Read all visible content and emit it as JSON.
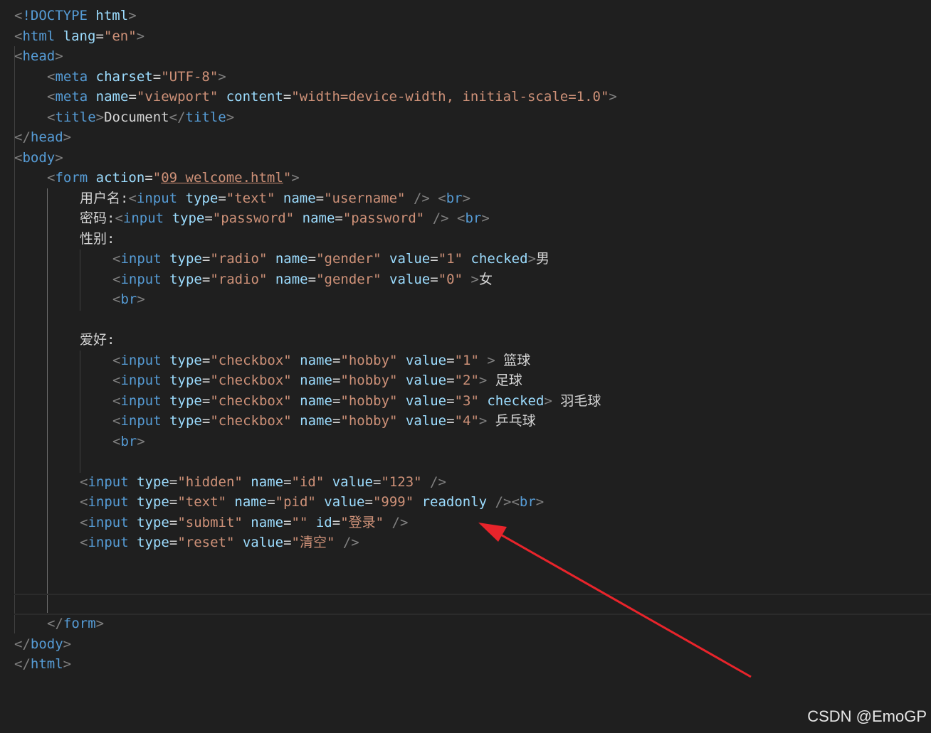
{
  "editor": {
    "theme": {
      "background": "#1f1f1f",
      "tag": "#569cd6",
      "attribute": "#9cdcfe",
      "string": "#ce9178",
      "text": "#d4d4d4",
      "punctuation": "#808080"
    },
    "lines": [
      {
        "t": [
          [
            "p",
            "<"
          ],
          [
            "tag",
            "!DOCTYPE"
          ],
          [
            "txt",
            " "
          ],
          [
            "attr",
            "html"
          ],
          [
            "p",
            ">"
          ]
        ]
      },
      {
        "t": [
          [
            "p",
            "<"
          ],
          [
            "tag",
            "html"
          ],
          [
            "txt",
            " "
          ],
          [
            "attr",
            "lang"
          ],
          [
            "txt",
            "="
          ],
          [
            "str",
            "\"en\""
          ],
          [
            "p",
            ">"
          ]
        ]
      },
      {
        "t": [
          [
            "p",
            "<"
          ],
          [
            "tag",
            "head"
          ],
          [
            "p",
            ">"
          ]
        ]
      },
      {
        "indent": 1,
        "t": [
          [
            "p",
            "<"
          ],
          [
            "tag",
            "meta"
          ],
          [
            "txt",
            " "
          ],
          [
            "attr",
            "charset"
          ],
          [
            "txt",
            "="
          ],
          [
            "str",
            "\"UTF-8\""
          ],
          [
            "p",
            ">"
          ]
        ]
      },
      {
        "indent": 1,
        "t": [
          [
            "p",
            "<"
          ],
          [
            "tag",
            "meta"
          ],
          [
            "txt",
            " "
          ],
          [
            "attr",
            "name"
          ],
          [
            "txt",
            "="
          ],
          [
            "str",
            "\"viewport\""
          ],
          [
            "txt",
            " "
          ],
          [
            "attr",
            "content"
          ],
          [
            "txt",
            "="
          ],
          [
            "str",
            "\"width=device-width, initial-scale=1.0\""
          ],
          [
            "p",
            ">"
          ]
        ]
      },
      {
        "indent": 1,
        "t": [
          [
            "p",
            "<"
          ],
          [
            "tag",
            "title"
          ],
          [
            "p",
            ">"
          ],
          [
            "txt",
            "Document"
          ],
          [
            "p",
            "</"
          ],
          [
            "tag",
            "title"
          ],
          [
            "p",
            ">"
          ]
        ]
      },
      {
        "t": [
          [
            "p",
            "</"
          ],
          [
            "tag",
            "head"
          ],
          [
            "p",
            ">"
          ]
        ]
      },
      {
        "t": [
          [
            "p",
            "<"
          ],
          [
            "tag",
            "body"
          ],
          [
            "p",
            ">"
          ]
        ]
      },
      {
        "indent": 1,
        "t": [
          [
            "p",
            "<"
          ],
          [
            "tag",
            "form"
          ],
          [
            "txt",
            " "
          ],
          [
            "attr",
            "action"
          ],
          [
            "txt",
            "="
          ],
          [
            "str",
            "\""
          ],
          [
            "link",
            "09 welcome.html"
          ],
          [
            "str",
            "\""
          ],
          [
            "p",
            ">"
          ]
        ]
      },
      {
        "indent": 2,
        "t": [
          [
            "txt",
            "用户名:"
          ],
          [
            "p",
            "<"
          ],
          [
            "tag",
            "input"
          ],
          [
            "txt",
            " "
          ],
          [
            "attr",
            "type"
          ],
          [
            "txt",
            "="
          ],
          [
            "str",
            "\"text\""
          ],
          [
            "txt",
            " "
          ],
          [
            "attr",
            "name"
          ],
          [
            "txt",
            "="
          ],
          [
            "str",
            "\"username\""
          ],
          [
            "txt",
            " "
          ],
          [
            "p",
            "/>"
          ],
          [
            "txt",
            " "
          ],
          [
            "p",
            "<"
          ],
          [
            "tag",
            "br"
          ],
          [
            "p",
            ">"
          ]
        ]
      },
      {
        "indent": 2,
        "t": [
          [
            "txt",
            "密码:"
          ],
          [
            "p",
            "<"
          ],
          [
            "tag",
            "input"
          ],
          [
            "txt",
            " "
          ],
          [
            "attr",
            "type"
          ],
          [
            "txt",
            "="
          ],
          [
            "str",
            "\"password\""
          ],
          [
            "txt",
            " "
          ],
          [
            "attr",
            "name"
          ],
          [
            "txt",
            "="
          ],
          [
            "str",
            "\"password\""
          ],
          [
            "txt",
            " "
          ],
          [
            "p",
            "/>"
          ],
          [
            "txt",
            " "
          ],
          [
            "p",
            "<"
          ],
          [
            "tag",
            "br"
          ],
          [
            "p",
            ">"
          ]
        ]
      },
      {
        "indent": 2,
        "t": [
          [
            "txt",
            "性别:"
          ]
        ]
      },
      {
        "indent": 3,
        "t": [
          [
            "p",
            "<"
          ],
          [
            "tag",
            "input"
          ],
          [
            "txt",
            " "
          ],
          [
            "attr",
            "type"
          ],
          [
            "txt",
            "="
          ],
          [
            "str",
            "\"radio\""
          ],
          [
            "txt",
            " "
          ],
          [
            "attr",
            "name"
          ],
          [
            "txt",
            "="
          ],
          [
            "str",
            "\"gender\""
          ],
          [
            "txt",
            " "
          ],
          [
            "attr",
            "value"
          ],
          [
            "txt",
            "="
          ],
          [
            "str",
            "\"1\""
          ],
          [
            "txt",
            " "
          ],
          [
            "attr",
            "checked"
          ],
          [
            "p",
            ">"
          ],
          [
            "txt",
            "男"
          ]
        ]
      },
      {
        "indent": 3,
        "t": [
          [
            "p",
            "<"
          ],
          [
            "tag",
            "input"
          ],
          [
            "txt",
            " "
          ],
          [
            "attr",
            "type"
          ],
          [
            "txt",
            "="
          ],
          [
            "str",
            "\"radio\""
          ],
          [
            "txt",
            " "
          ],
          [
            "attr",
            "name"
          ],
          [
            "txt",
            "="
          ],
          [
            "str",
            "\"gender\""
          ],
          [
            "txt",
            " "
          ],
          [
            "attr",
            "value"
          ],
          [
            "txt",
            "="
          ],
          [
            "str",
            "\"0\""
          ],
          [
            "txt",
            " "
          ],
          [
            "p",
            ">"
          ],
          [
            "txt",
            "女"
          ]
        ]
      },
      {
        "indent": 3,
        "t": [
          [
            "p",
            "<"
          ],
          [
            "tag",
            "br"
          ],
          [
            "p",
            ">"
          ]
        ]
      },
      {
        "t": []
      },
      {
        "indent": 2,
        "t": [
          [
            "txt",
            "爱好:"
          ]
        ]
      },
      {
        "indent": 3,
        "t": [
          [
            "p",
            "<"
          ],
          [
            "tag",
            "input"
          ],
          [
            "txt",
            " "
          ],
          [
            "attr",
            "type"
          ],
          [
            "txt",
            "="
          ],
          [
            "str",
            "\"checkbox\""
          ],
          [
            "txt",
            " "
          ],
          [
            "attr",
            "name"
          ],
          [
            "txt",
            "="
          ],
          [
            "str",
            "\"hobby\""
          ],
          [
            "txt",
            " "
          ],
          [
            "attr",
            "value"
          ],
          [
            "txt",
            "="
          ],
          [
            "str",
            "\"1\""
          ],
          [
            "txt",
            " "
          ],
          [
            "p",
            ">"
          ],
          [
            "txt",
            " 篮球"
          ]
        ]
      },
      {
        "indent": 3,
        "t": [
          [
            "p",
            "<"
          ],
          [
            "tag",
            "input"
          ],
          [
            "txt",
            " "
          ],
          [
            "attr",
            "type"
          ],
          [
            "txt",
            "="
          ],
          [
            "str",
            "\"checkbox\""
          ],
          [
            "txt",
            " "
          ],
          [
            "attr",
            "name"
          ],
          [
            "txt",
            "="
          ],
          [
            "str",
            "\"hobby\""
          ],
          [
            "txt",
            " "
          ],
          [
            "attr",
            "value"
          ],
          [
            "txt",
            "="
          ],
          [
            "str",
            "\"2\""
          ],
          [
            "p",
            ">"
          ],
          [
            "txt",
            " 足球"
          ]
        ]
      },
      {
        "indent": 3,
        "t": [
          [
            "p",
            "<"
          ],
          [
            "tag",
            "input"
          ],
          [
            "txt",
            " "
          ],
          [
            "attr",
            "type"
          ],
          [
            "txt",
            "="
          ],
          [
            "str",
            "\"checkbox\""
          ],
          [
            "txt",
            " "
          ],
          [
            "attr",
            "name"
          ],
          [
            "txt",
            "="
          ],
          [
            "str",
            "\"hobby\""
          ],
          [
            "txt",
            " "
          ],
          [
            "attr",
            "value"
          ],
          [
            "txt",
            "="
          ],
          [
            "str",
            "\"3\""
          ],
          [
            "txt",
            " "
          ],
          [
            "attr",
            "checked"
          ],
          [
            "p",
            ">"
          ],
          [
            "txt",
            " 羽毛球"
          ]
        ]
      },
      {
        "indent": 3,
        "t": [
          [
            "p",
            "<"
          ],
          [
            "tag",
            "input"
          ],
          [
            "txt",
            " "
          ],
          [
            "attr",
            "type"
          ],
          [
            "txt",
            "="
          ],
          [
            "str",
            "\"checkbox\""
          ],
          [
            "txt",
            " "
          ],
          [
            "attr",
            "name"
          ],
          [
            "txt",
            "="
          ],
          [
            "str",
            "\"hobby\""
          ],
          [
            "txt",
            " "
          ],
          [
            "attr",
            "value"
          ],
          [
            "txt",
            "="
          ],
          [
            "str",
            "\"4\""
          ],
          [
            "p",
            ">"
          ],
          [
            "txt",
            " 乒乓球"
          ]
        ]
      },
      {
        "indent": 3,
        "t": [
          [
            "p",
            "<"
          ],
          [
            "tag",
            "br"
          ],
          [
            "p",
            ">"
          ]
        ]
      },
      {
        "t": []
      },
      {
        "indent": 2,
        "t": [
          [
            "p",
            "<"
          ],
          [
            "tag",
            "input"
          ],
          [
            "txt",
            " "
          ],
          [
            "attr",
            "type"
          ],
          [
            "txt",
            "="
          ],
          [
            "str",
            "\"hidden\""
          ],
          [
            "txt",
            " "
          ],
          [
            "attr",
            "name"
          ],
          [
            "txt",
            "="
          ],
          [
            "str",
            "\"id\""
          ],
          [
            "txt",
            " "
          ],
          [
            "attr",
            "value"
          ],
          [
            "txt",
            "="
          ],
          [
            "str",
            "\"123\""
          ],
          [
            "txt",
            " "
          ],
          [
            "p",
            "/>"
          ]
        ]
      },
      {
        "indent": 2,
        "t": [
          [
            "p",
            "<"
          ],
          [
            "tag",
            "input"
          ],
          [
            "txt",
            " "
          ],
          [
            "attr",
            "type"
          ],
          [
            "txt",
            "="
          ],
          [
            "str",
            "\"text\""
          ],
          [
            "txt",
            " "
          ],
          [
            "attr",
            "name"
          ],
          [
            "txt",
            "="
          ],
          [
            "str",
            "\"pid\""
          ],
          [
            "txt",
            " "
          ],
          [
            "attr",
            "value"
          ],
          [
            "txt",
            "="
          ],
          [
            "str",
            "\"999\""
          ],
          [
            "txt",
            " "
          ],
          [
            "attr",
            "readonly"
          ],
          [
            "txt",
            " "
          ],
          [
            "p",
            "/><"
          ],
          [
            "tag",
            "br"
          ],
          [
            "p",
            ">"
          ]
        ]
      },
      {
        "indent": 2,
        "t": [
          [
            "p",
            "<"
          ],
          [
            "tag",
            "input"
          ],
          [
            "txt",
            " "
          ],
          [
            "attr",
            "type"
          ],
          [
            "txt",
            "="
          ],
          [
            "str",
            "\"submit\""
          ],
          [
            "txt",
            " "
          ],
          [
            "attr",
            "name"
          ],
          [
            "txt",
            "="
          ],
          [
            "str",
            "\"\""
          ],
          [
            "txt",
            " "
          ],
          [
            "attr",
            "id"
          ],
          [
            "txt",
            "="
          ],
          [
            "str",
            "\"登录\""
          ],
          [
            "txt",
            " "
          ],
          [
            "p",
            "/>"
          ]
        ]
      },
      {
        "indent": 2,
        "t": [
          [
            "p",
            "<"
          ],
          [
            "tag",
            "input"
          ],
          [
            "txt",
            " "
          ],
          [
            "attr",
            "type"
          ],
          [
            "txt",
            "="
          ],
          [
            "str",
            "\"reset\""
          ],
          [
            "txt",
            " "
          ],
          [
            "attr",
            "value"
          ],
          [
            "txt",
            "="
          ],
          [
            "str",
            "\"清空\""
          ],
          [
            "txt",
            " "
          ],
          [
            "p",
            "/>"
          ]
        ]
      },
      {
        "t": []
      },
      {
        "t": []
      },
      {
        "t": [],
        "cursor": true
      },
      {
        "indent": 1,
        "t": [
          [
            "p",
            "</"
          ],
          [
            "tag",
            "form"
          ],
          [
            "p",
            ">"
          ]
        ]
      },
      {
        "t": [
          [
            "p",
            "</"
          ],
          [
            "tag",
            "body"
          ],
          [
            "p",
            ">"
          ]
        ]
      },
      {
        "t": [
          [
            "p",
            "</"
          ],
          [
            "tag",
            "html"
          ],
          [
            "p",
            ">"
          ]
        ]
      }
    ]
  },
  "annotation": {
    "arrow_color": "#e8242b"
  },
  "watermark": "CSDN @EmoGP"
}
